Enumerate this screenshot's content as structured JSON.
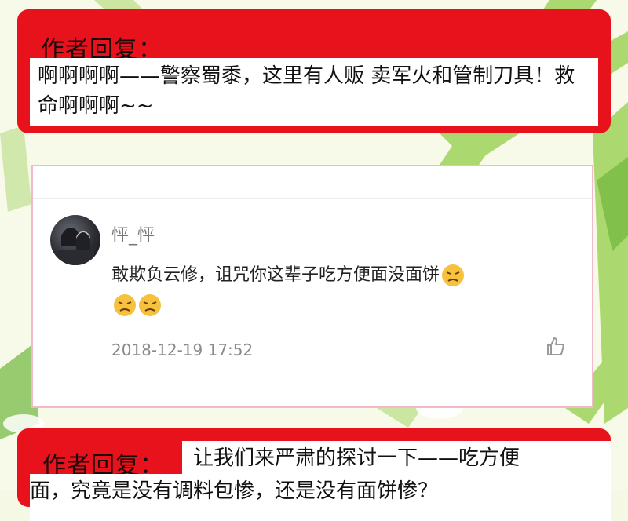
{
  "reply1": {
    "label": "作者回复：",
    "text": "啊啊啊啊——警察蜀黍，这里有人贩 卖军火和管制刀具！救命啊啊啊~~"
  },
  "comment": {
    "username": "怦_怦",
    "text": "敢欺负云修，诅咒你这辈子吃方便面没面饼",
    "emoji": "angry-face-icon",
    "timestamp": "2018-12-19 17:52",
    "like_icon": "thumbs-up-icon"
  },
  "reply2": {
    "label": "作者回复：",
    "text_line1": "让我们来严肃的探讨一下——吃方便",
    "text_line2": "面，究竟是没有调料包惨，还是没有面饼惨？"
  },
  "colors": {
    "reply_red": "#e8121d",
    "card_border": "#f1b9c9",
    "background": "#f6f8e6"
  }
}
